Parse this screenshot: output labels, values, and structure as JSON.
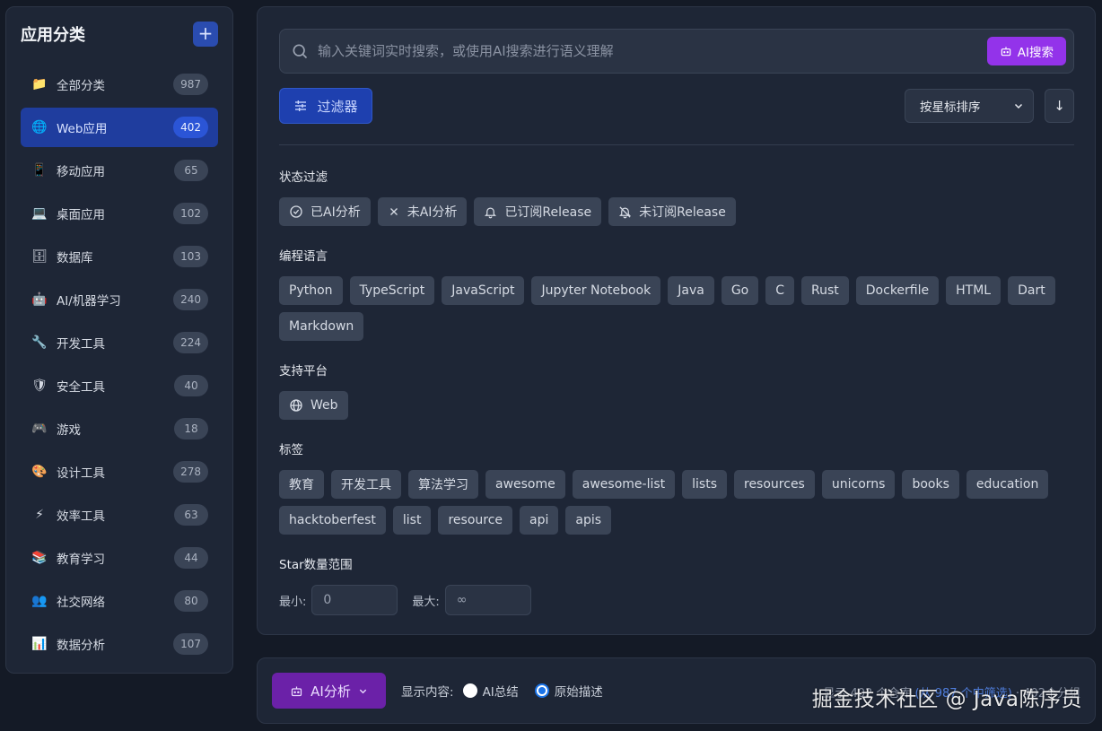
{
  "sidebar": {
    "title": "应用分类",
    "add_label": "+",
    "items": [
      {
        "icon": "📁",
        "icon_name": "folder-icon",
        "label": "全部分类",
        "count": "987",
        "active": false
      },
      {
        "icon": "🌐",
        "icon_name": "globe-icon",
        "label": "Web应用",
        "count": "402",
        "active": true
      },
      {
        "icon": "📱",
        "icon_name": "mobile-phone-icon",
        "label": "移动应用",
        "count": "65",
        "active": false
      },
      {
        "icon": "💻",
        "icon_name": "laptop-icon",
        "label": "桌面应用",
        "count": "102",
        "active": false
      },
      {
        "icon": "🗄",
        "icon_name": "database-cabinet-icon",
        "label": "数据库",
        "count": "103",
        "active": false
      },
      {
        "icon": "🤖",
        "icon_name": "robot-icon",
        "label": "AI/机器学习",
        "count": "240",
        "active": false
      },
      {
        "icon": "🔧",
        "icon_name": "tool-icon",
        "label": "开发工具",
        "count": "224",
        "active": false
      },
      {
        "icon": "🛡",
        "icon_name": "shield-icon",
        "label": "安全工具",
        "count": "40",
        "active": false
      },
      {
        "icon": "🎮",
        "icon_name": "gamepad-icon",
        "label": "游戏",
        "count": "18",
        "active": false
      },
      {
        "icon": "🎨",
        "icon_name": "palette-icon",
        "label": "设计工具",
        "count": "278",
        "active": false
      },
      {
        "icon": "⚡",
        "icon_name": "lightning-icon",
        "label": "效率工具",
        "count": "63",
        "active": false
      },
      {
        "icon": "📚",
        "icon_name": "books-icon",
        "label": "教育学习",
        "count": "44",
        "active": false
      },
      {
        "icon": "👥",
        "icon_name": "people-icon",
        "label": "社交网络",
        "count": "80",
        "active": false
      },
      {
        "icon": "📊",
        "icon_name": "bar-chart-icon",
        "label": "数据分析",
        "count": "107",
        "active": false
      }
    ]
  },
  "search": {
    "placeholder": "输入关键词实时搜索，或使用AI搜索进行语义理解",
    "value": "",
    "ai_button": "AI搜索"
  },
  "toolbar": {
    "filter_label": "过滤器",
    "sort_value": "按星标排序",
    "sort_dir_icon": "↓"
  },
  "filters": {
    "status": {
      "title": "状态过滤",
      "chips": [
        {
          "label": "已AI分析",
          "icon_name": "check-circle-icon"
        },
        {
          "label": "未AI分析",
          "icon_name": "x-icon"
        },
        {
          "label": "已订阅Release",
          "icon_name": "bell-icon"
        },
        {
          "label": "未订阅Release",
          "icon_name": "bell-off-icon"
        }
      ]
    },
    "languages": {
      "title": "编程语言",
      "chips": [
        "Python",
        "TypeScript",
        "JavaScript",
        "Jupyter Notebook",
        "Java",
        "Go",
        "C",
        "Rust",
        "Dockerfile",
        "HTML",
        "Dart",
        "Markdown"
      ]
    },
    "platforms": {
      "title": "支持平台",
      "chips": [
        {
          "label": "Web",
          "icon_name": "globe-icon"
        }
      ]
    },
    "tags": {
      "title": "标签",
      "chips": [
        "教育",
        "开发工具",
        "算法学习",
        "awesome",
        "awesome-list",
        "lists",
        "resources",
        "unicorns",
        "books",
        "education",
        "hacktoberfest",
        "list",
        "resource",
        "api",
        "apis"
      ]
    },
    "stars": {
      "title": "Star数量范围",
      "min_label": "最小:",
      "min_value": "0",
      "max_label": "最大:",
      "max_value": "∞"
    }
  },
  "bottom": {
    "ai_analyze_label": "AI分析",
    "display_label": "显示内容:",
    "options": [
      {
        "label": "AI总结",
        "checked": false
      },
      {
        "label": "原始描述",
        "checked": true
      }
    ],
    "stats_prefix": "显示 402 个仓库",
    "stats_link": "(从 987 个中筛选)",
    "stats_suffix": "· 402个分组"
  },
  "watermark": "掘金技术社区 @ Java陈序员",
  "colors": {
    "accent_blue": "#1e40af",
    "accent_purple": "#9333ea",
    "dark_purple": "#6b21a8",
    "panel_bg": "#1e2636",
    "page_bg": "#141a26"
  }
}
